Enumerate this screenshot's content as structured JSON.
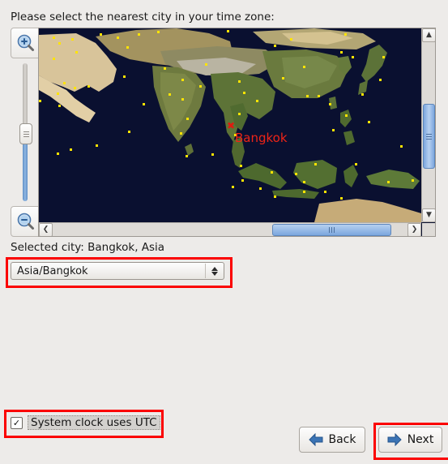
{
  "prompt": "Please select the nearest city in your time zone:",
  "map": {
    "zoom_in_icon": "magnifier-plus-icon",
    "zoom_out_icon": "magnifier-minus-icon",
    "marker_symbol": "✖",
    "selected_city_label": "Bangkok",
    "marker_color": "#ef2417",
    "city_dot_color": "#ffe400",
    "ocean_color": "#0a1030",
    "scroll": {
      "up_arrow": "▲",
      "down_arrow": "▼",
      "left_arrow": "❮",
      "right_arrow": "❯"
    }
  },
  "selected": {
    "label": "Selected city: Bangkok, Asia",
    "timezone_value": "Asia/Bangkok",
    "timezone_options": [
      "Asia/Bangkok"
    ]
  },
  "utc": {
    "label": "System clock uses UTC",
    "checked": true,
    "check_glyph": "✓"
  },
  "buttons": {
    "back": "Back",
    "next": "Next"
  },
  "highlight_color": "#fb0000"
}
